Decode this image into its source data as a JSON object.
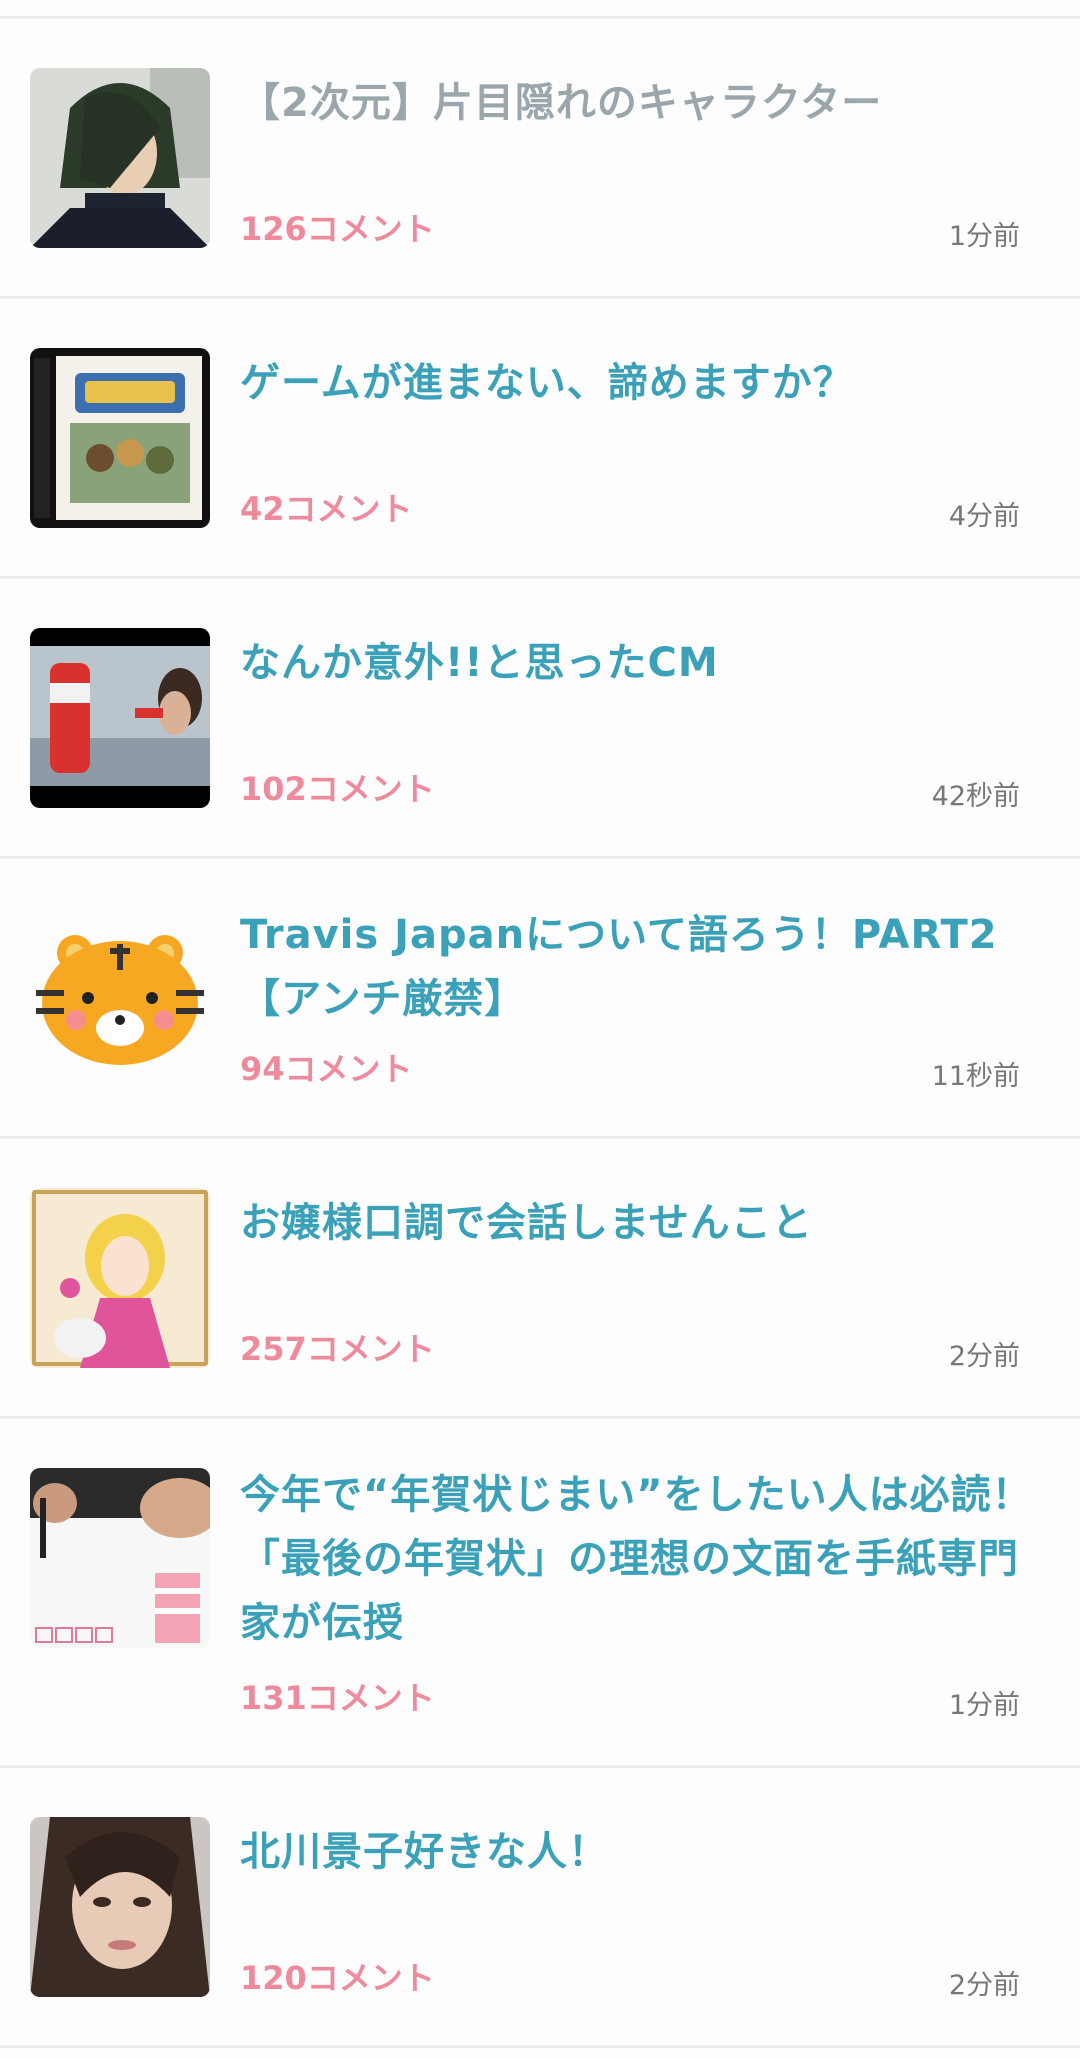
{
  "topics": [
    {
      "title": "【2次元】片目隠れのキャラクター",
      "comments": "126コメント",
      "time": "1分前",
      "visited": true,
      "thumb": "anime-character"
    },
    {
      "title": "ゲームが進まない、諦めますか？",
      "comments": "42コメント",
      "time": "4分前",
      "visited": false,
      "thumb": "game-box"
    },
    {
      "title": "なんか意外!!と思ったCM",
      "comments": "102コメント",
      "time": "42秒前",
      "visited": false,
      "thumb": "cm-drink"
    },
    {
      "title": "Travis Japanについて語ろう！PART2【アンチ厳禁】",
      "comments": "94コメント",
      "time": "11秒前",
      "visited": false,
      "thumb": "tiger"
    },
    {
      "title": "お嬢様口調で会話しませんこと",
      "comments": "257コメント",
      "time": "2分前",
      "visited": false,
      "thumb": "lady-illustration"
    },
    {
      "title": "今年で“年賀状じまい”をしたい人は必読！「最後の年賀状」の理想の文面を手紙専門家が伝授",
      "comments": "131コメント",
      "time": "1分前",
      "visited": false,
      "thumb": "new-year-card"
    },
    {
      "title": "北川景子好きな人！",
      "comments": "120コメント",
      "time": "2分前",
      "visited": false,
      "thumb": "woman-portrait"
    }
  ],
  "colors": {
    "title": "#3aa1b8",
    "visited": "#9aa6ab",
    "comments": "#ef8a9d",
    "time": "#777777"
  }
}
